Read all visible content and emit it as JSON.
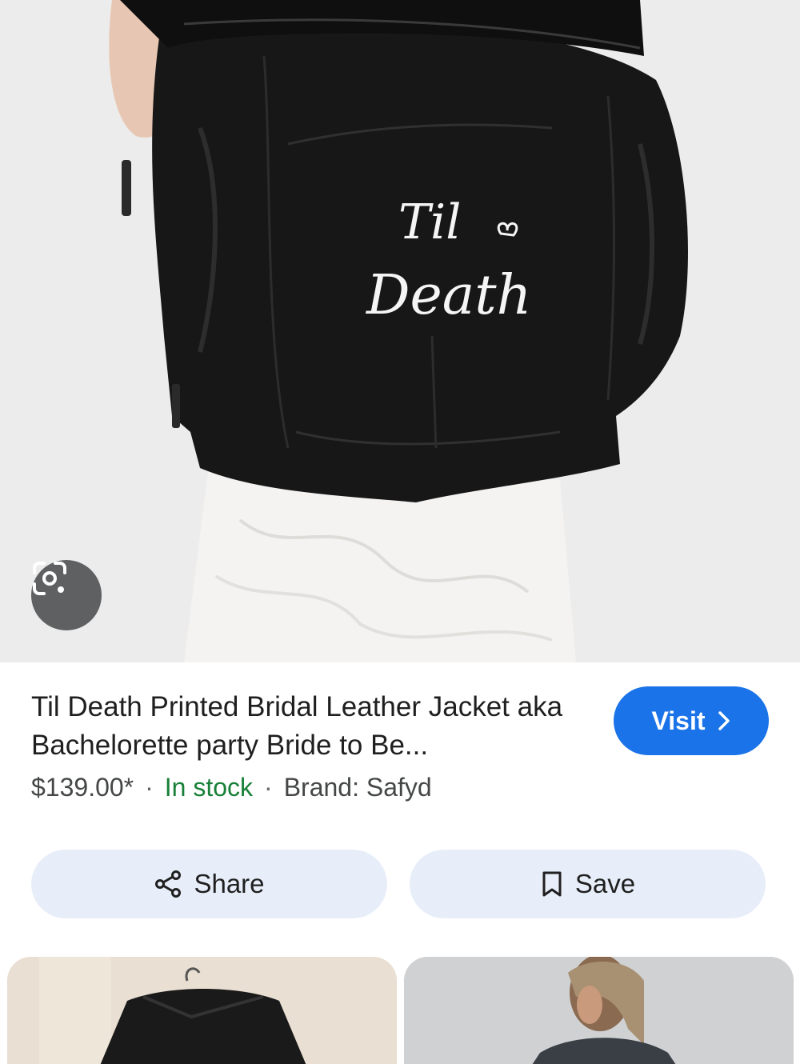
{
  "hero": {
    "image_text_line1": "Til",
    "image_text_line2": "Death",
    "lens_icon": "google-lens-icon"
  },
  "product": {
    "title": "Til Death Printed Bridal Leather Jacket aka Bachelorette party Bride to Be...",
    "price": "$139.00*",
    "separator": "·",
    "stock": "In stock",
    "brand": "Brand: Safyd"
  },
  "visit_button": {
    "label": "Visit",
    "icon": "chevron-right-icon"
  },
  "actions": {
    "share": {
      "label": "Share",
      "icon": "share-icon"
    },
    "save": {
      "label": "Save",
      "icon": "bookmark-icon"
    }
  },
  "colors": {
    "primary": "#1a73e8",
    "stock_green": "#188038",
    "action_bg": "#e8eef9",
    "lens_bg": "#5f6061"
  }
}
